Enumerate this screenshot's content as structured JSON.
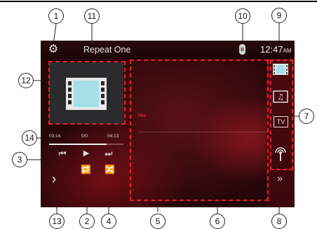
{
  "status_bar": {
    "mode_label": "Repeat One",
    "time": "12:47",
    "am_pm": "AM",
    "bluetooth_glyph": "ʙ"
  },
  "player": {
    "elapsed": "03:14",
    "track_count": "0/0",
    "total": "04:13",
    "progress_fraction": 0.77,
    "title": "Title"
  },
  "icons": {
    "settings": "settings-gear-icon",
    "prev": "previous-track-icon",
    "play": "play-icon",
    "next": "next-track-icon",
    "repeat": "repeat-icon",
    "shuffle": "shuffle-icon",
    "back": "back-arrow-icon",
    "more": "expand-more-icon",
    "video": "video-source-icon",
    "music": "music-source-icon",
    "tv": "tv-source-icon",
    "radio": "radio-source-icon"
  },
  "source_buttons": {
    "tv_label": "TV"
  },
  "callouts": {
    "c1": "1",
    "c2": "2",
    "c3": "3",
    "c4": "4",
    "c5": "5",
    "c6": "6",
    "c7": "7",
    "c8": "8",
    "c9": "9",
    "c10": "10",
    "c11": "11",
    "c12": "12",
    "c13": "13",
    "c14": "14"
  },
  "colors": {
    "highlight_dash": "#e8202e",
    "background_dark": "#260608",
    "title_red": "#ff3340"
  }
}
